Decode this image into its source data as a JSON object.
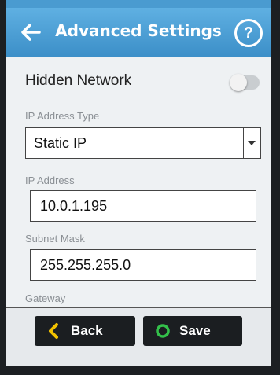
{
  "header": {
    "title": "Advanced Settings",
    "help_label": "?"
  },
  "hidden_network": {
    "label": "Hidden Network",
    "enabled": false
  },
  "ip_address_type": {
    "label": "IP Address Type",
    "selected": "Static IP"
  },
  "ip_address": {
    "label": "IP Address",
    "value": "10.0.1.195"
  },
  "subnet_mask": {
    "label": "Subnet Mask",
    "value": "255.255.255.0"
  },
  "gateway": {
    "label": "Gateway"
  },
  "buttons": {
    "back": "Back",
    "save": "Save"
  },
  "colors": {
    "header": "#4a9bd0",
    "back_icon": "#f2c200",
    "save_icon": "#33c04a"
  }
}
